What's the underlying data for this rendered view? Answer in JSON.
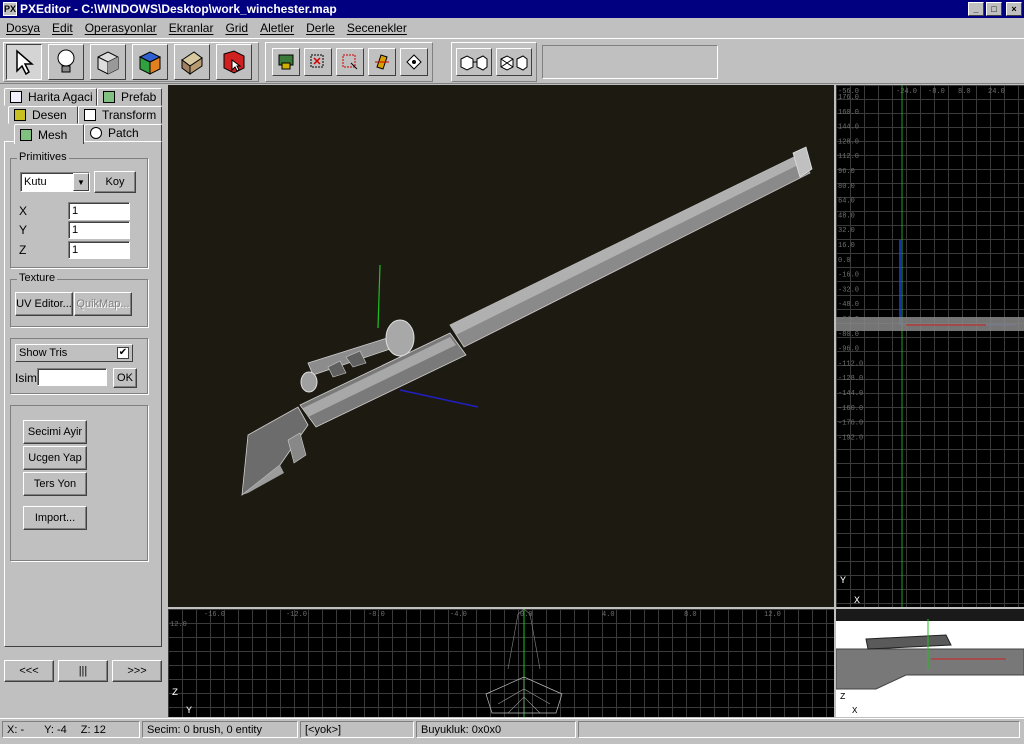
{
  "app": {
    "title": "PXEditor - C:\\WINDOWS\\Desktop\\work_winchester.map",
    "icon_glyph": "PX"
  },
  "window_controls": {
    "minimize": "_",
    "maximize": "□",
    "close": "×"
  },
  "menu": [
    "Dosya",
    "Edit",
    "Operasyonlar",
    "Ekranlar",
    "Grid",
    "Aletler",
    "Derle",
    "Secenekler"
  ],
  "toolbar": {
    "main_tools": [
      "select-arrow-icon",
      "light-bulb-icon",
      "cube-icon",
      "colored-cube-icon",
      "texture-box-icon",
      "red-cursor-icon"
    ],
    "mid_tools": [
      "layer-icon",
      "select-red-icon",
      "deselect-icon",
      "clip-icon",
      "vertex-icon"
    ],
    "right_tools": [
      "cube-arrow-icon",
      "cube-grid-icon"
    ],
    "info_box": ""
  },
  "tabs": {
    "row1": [
      "Harita Agaci",
      "Prefab"
    ],
    "row2": [
      "Desen",
      "Transform"
    ],
    "row3": [
      "Mesh",
      "Patch"
    ]
  },
  "primitives": {
    "group_label": "Primitives",
    "shape_selected": "Kutu",
    "create_button": "Koy",
    "x_label": "X",
    "x_value": "1",
    "y_label": "Y",
    "y_value": "1",
    "z_label": "Z",
    "z_value": "1"
  },
  "texture": {
    "group_label": "Texture",
    "uv_editor": "UV Editor...",
    "quikmap": "QuikMap..."
  },
  "show_tris": {
    "label": "Show Tris",
    "checked": true,
    "name_label": "Isim",
    "name_value": "",
    "ok": "OK"
  },
  "actions": [
    "Secimi Ayir",
    "Ucgen Yap",
    "Ters Yon",
    "Import..."
  ],
  "nav": [
    "<<<",
    "|||",
    ">>>"
  ],
  "front_view": {
    "ticks": [
      "-16.0",
      "-12.0",
      "-8.0",
      "-4.0",
      "0.0",
      "4.0",
      "8.0",
      "12.0"
    ],
    "row_label": "12.0",
    "axis_labels": [
      "Z",
      "Y"
    ]
  },
  "side_view": {
    "top_ticks": [
      "-56.0",
      "-24.0",
      "-8.0",
      "8.0",
      "24.0"
    ],
    "left_ticks": [
      "176.0",
      "160.0",
      "144.0",
      "128.0",
      "112.0",
      "96.0",
      "80.0",
      "64.0",
      "48.0",
      "32.0",
      "16.0",
      "0.0",
      "-16.0",
      "-32.0",
      "-48.0",
      "-64.0",
      "-80.0",
      "-96.0",
      "-112.0",
      "-128.0",
      "-144.0",
      "-160.0",
      "-176.0",
      "-192.0"
    ],
    "axis_labels": [
      "Y",
      "X"
    ]
  },
  "texture_view": {
    "axis_labels": [
      "Z",
      "X"
    ]
  },
  "status": {
    "x": "X: -",
    "y": "Y: -4",
    "z": "Z: 12",
    "selection": "Secim: 0 brush, 0 entity",
    "entity": "[<yok>]",
    "size": "Buyukluk: 0x0x0"
  }
}
